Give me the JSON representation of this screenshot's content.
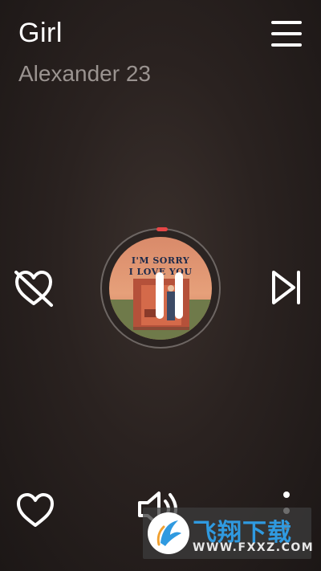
{
  "track": {
    "title": "Girl",
    "artist": "Alexander 23"
  },
  "album_cover": {
    "line1": "I'M SORRY",
    "line2": "I LOVE YOU"
  },
  "playback": {
    "state": "playing",
    "progress": 0.02
  },
  "icons": {
    "menu": "hamburger-menu-icon",
    "dislike": "heart-slash-icon",
    "pause": "pause-icon",
    "next": "skip-next-icon",
    "like": "heart-outline-icon",
    "volume": "volume-icon",
    "more": "more-vertical-icon"
  },
  "watermark": {
    "name": "飞翔下载",
    "url": "WWW.FXXZ.COM"
  },
  "colors": {
    "accent": "#e64646",
    "watermark_blue": "#2f9ae0"
  }
}
